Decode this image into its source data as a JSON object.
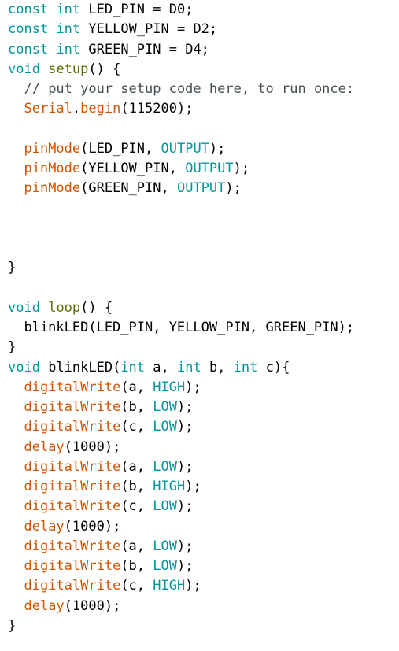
{
  "editor": {
    "colors": {
      "keyword": "#00979c",
      "builtin": "#d35400",
      "setup": "#5e6d03",
      "const": "#00979c",
      "comment": "#434f54",
      "plain": "#000000"
    },
    "lines": [
      {
        "tokens": [
          [
            "keyword",
            "const"
          ],
          [
            "plain",
            " "
          ],
          [
            "keyword",
            "int"
          ],
          [
            "plain",
            " LED_PIN = D0;"
          ]
        ]
      },
      {
        "tokens": [
          [
            "keyword",
            "const"
          ],
          [
            "plain",
            " "
          ],
          [
            "keyword",
            "int"
          ],
          [
            "plain",
            " YELLOW_PIN = D2;"
          ]
        ]
      },
      {
        "tokens": [
          [
            "keyword",
            "const"
          ],
          [
            "plain",
            " "
          ],
          [
            "keyword",
            "int"
          ],
          [
            "plain",
            " GREEN_PIN = D4;"
          ]
        ]
      },
      {
        "tokens": [
          [
            "keyword",
            "void"
          ],
          [
            "plain",
            " "
          ],
          [
            "setup",
            "setup"
          ],
          [
            "plain",
            "() {"
          ]
        ]
      },
      {
        "tokens": [
          [
            "plain",
            "  "
          ],
          [
            "comment",
            "// put your setup code here, to run once:"
          ]
        ]
      },
      {
        "tokens": [
          [
            "plain",
            "  "
          ],
          [
            "builtin",
            "Serial"
          ],
          [
            "plain",
            "."
          ],
          [
            "builtin",
            "begin"
          ],
          [
            "plain",
            "(115200);"
          ]
        ]
      },
      {
        "tokens": []
      },
      {
        "tokens": [
          [
            "plain",
            "  "
          ],
          [
            "builtin",
            "pinMode"
          ],
          [
            "plain",
            "(LED_PIN, "
          ],
          [
            "const",
            "OUTPUT"
          ],
          [
            "plain",
            ");"
          ]
        ]
      },
      {
        "tokens": [
          [
            "plain",
            "  "
          ],
          [
            "builtin",
            "pinMode"
          ],
          [
            "plain",
            "(YELLOW_PIN, "
          ],
          [
            "const",
            "OUTPUT"
          ],
          [
            "plain",
            ");"
          ]
        ]
      },
      {
        "tokens": [
          [
            "plain",
            "  "
          ],
          [
            "builtin",
            "pinMode"
          ],
          [
            "plain",
            "(GREEN_PIN, "
          ],
          [
            "const",
            "OUTPUT"
          ],
          [
            "plain",
            ");"
          ]
        ]
      },
      {
        "tokens": []
      },
      {
        "tokens": []
      },
      {
        "tokens": []
      },
      {
        "tokens": [
          [
            "plain",
            "}"
          ]
        ]
      },
      {
        "tokens": []
      },
      {
        "tokens": [
          [
            "keyword",
            "void"
          ],
          [
            "plain",
            " "
          ],
          [
            "setup",
            "loop"
          ],
          [
            "plain",
            "() {"
          ]
        ]
      },
      {
        "tokens": [
          [
            "plain",
            "  blinkLED(LED_PIN, YELLOW_PIN, GREEN_PIN);"
          ]
        ]
      },
      {
        "tokens": [
          [
            "plain",
            "}"
          ]
        ]
      },
      {
        "tokens": [
          [
            "keyword",
            "void"
          ],
          [
            "plain",
            " blinkLED("
          ],
          [
            "keyword",
            "int"
          ],
          [
            "plain",
            " a, "
          ],
          [
            "keyword",
            "int"
          ],
          [
            "plain",
            " b, "
          ],
          [
            "keyword",
            "int"
          ],
          [
            "plain",
            " c){"
          ]
        ]
      },
      {
        "tokens": [
          [
            "plain",
            "  "
          ],
          [
            "builtin",
            "digitalWrite"
          ],
          [
            "plain",
            "(a, "
          ],
          [
            "const",
            "HIGH"
          ],
          [
            "plain",
            ");"
          ]
        ]
      },
      {
        "tokens": [
          [
            "plain",
            "  "
          ],
          [
            "builtin",
            "digitalWrite"
          ],
          [
            "plain",
            "(b, "
          ],
          [
            "const",
            "LOW"
          ],
          [
            "plain",
            ");"
          ]
        ]
      },
      {
        "tokens": [
          [
            "plain",
            "  "
          ],
          [
            "builtin",
            "digitalWrite"
          ],
          [
            "plain",
            "(c, "
          ],
          [
            "const",
            "LOW"
          ],
          [
            "plain",
            ");"
          ]
        ]
      },
      {
        "tokens": [
          [
            "plain",
            "  "
          ],
          [
            "builtin",
            "delay"
          ],
          [
            "plain",
            "(1000);"
          ]
        ]
      },
      {
        "tokens": [
          [
            "plain",
            "  "
          ],
          [
            "builtin",
            "digitalWrite"
          ],
          [
            "plain",
            "(a, "
          ],
          [
            "const",
            "LOW"
          ],
          [
            "plain",
            ");"
          ]
        ]
      },
      {
        "tokens": [
          [
            "plain",
            "  "
          ],
          [
            "builtin",
            "digitalWrite"
          ],
          [
            "plain",
            "(b, "
          ],
          [
            "const",
            "HIGH"
          ],
          [
            "plain",
            ");"
          ]
        ]
      },
      {
        "tokens": [
          [
            "plain",
            "  "
          ],
          [
            "builtin",
            "digitalWrite"
          ],
          [
            "plain",
            "(c, "
          ],
          [
            "const",
            "LOW"
          ],
          [
            "plain",
            ");"
          ]
        ]
      },
      {
        "tokens": [
          [
            "plain",
            "  "
          ],
          [
            "builtin",
            "delay"
          ],
          [
            "plain",
            "(1000);"
          ]
        ]
      },
      {
        "tokens": [
          [
            "plain",
            "  "
          ],
          [
            "builtin",
            "digitalWrite"
          ],
          [
            "plain",
            "(a, "
          ],
          [
            "const",
            "LOW"
          ],
          [
            "plain",
            ");"
          ]
        ]
      },
      {
        "tokens": [
          [
            "plain",
            "  "
          ],
          [
            "builtin",
            "digitalWrite"
          ],
          [
            "plain",
            "(b, "
          ],
          [
            "const",
            "LOW"
          ],
          [
            "plain",
            ");"
          ]
        ]
      },
      {
        "tokens": [
          [
            "plain",
            "  "
          ],
          [
            "builtin",
            "digitalWrite"
          ],
          [
            "plain",
            "(c, "
          ],
          [
            "const",
            "HIGH"
          ],
          [
            "plain",
            ");"
          ]
        ]
      },
      {
        "tokens": [
          [
            "plain",
            "  "
          ],
          [
            "builtin",
            "delay"
          ],
          [
            "plain",
            "(1000);"
          ]
        ]
      },
      {
        "tokens": [
          [
            "plain",
            "}"
          ]
        ]
      }
    ]
  }
}
